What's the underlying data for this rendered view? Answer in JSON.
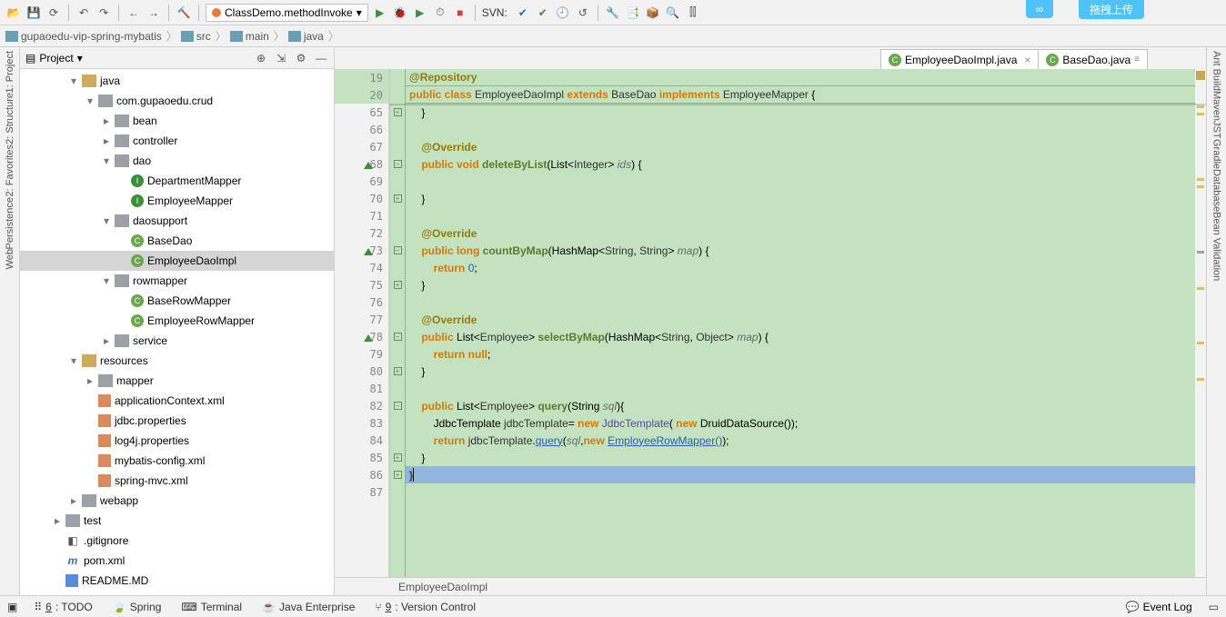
{
  "toolbar": {
    "run_config": "ClassDemo.methodInvoke",
    "svn_label": "SVN:"
  },
  "top_pill_text": "拖拽上传",
  "breadcrumbs": [
    "gupaoedu-vip-spring-mybatis",
    "src",
    "main",
    "java"
  ],
  "project": {
    "title": "Project",
    "tree": [
      {
        "depth": 3,
        "tw": "▾",
        "icon": "dir",
        "label": "java"
      },
      {
        "depth": 4,
        "tw": "▾",
        "icon": "pkg",
        "label": "com.gupaoedu.crud"
      },
      {
        "depth": 5,
        "tw": "▸",
        "icon": "pkg",
        "label": "bean"
      },
      {
        "depth": 5,
        "tw": "▸",
        "icon": "pkg",
        "label": "controller"
      },
      {
        "depth": 5,
        "tw": "▾",
        "icon": "pkg",
        "label": "dao"
      },
      {
        "depth": 6,
        "tw": "",
        "icon": "iface",
        "label": "DepartmentMapper"
      },
      {
        "depth": 6,
        "tw": "",
        "icon": "iface",
        "label": "EmployeeMapper"
      },
      {
        "depth": 5,
        "tw": "▾",
        "icon": "pkg",
        "label": "daosupport"
      },
      {
        "depth": 6,
        "tw": "",
        "icon": "cls",
        "label": "BaseDao"
      },
      {
        "depth": 6,
        "tw": "",
        "icon": "cls",
        "label": "EmployeeDaoImpl",
        "selected": true
      },
      {
        "depth": 5,
        "tw": "▾",
        "icon": "pkg",
        "label": "rowmapper"
      },
      {
        "depth": 6,
        "tw": "",
        "icon": "cls",
        "label": "BaseRowMapper"
      },
      {
        "depth": 6,
        "tw": "",
        "icon": "cls",
        "label": "EmployeeRowMapper"
      },
      {
        "depth": 5,
        "tw": "▸",
        "icon": "pkg",
        "label": "service"
      },
      {
        "depth": 3,
        "tw": "▾",
        "icon": "dir",
        "label": "resources"
      },
      {
        "depth": 4,
        "tw": "▸",
        "icon": "pkg",
        "label": "mapper"
      },
      {
        "depth": 4,
        "tw": "",
        "icon": "xml",
        "label": "applicationContext.xml"
      },
      {
        "depth": 4,
        "tw": "",
        "icon": "prop",
        "label": "jdbc.properties"
      },
      {
        "depth": 4,
        "tw": "",
        "icon": "prop",
        "label": "log4j.properties"
      },
      {
        "depth": 4,
        "tw": "",
        "icon": "xml",
        "label": "mybatis-config.xml"
      },
      {
        "depth": 4,
        "tw": "",
        "icon": "xml",
        "label": "spring-mvc.xml"
      },
      {
        "depth": 3,
        "tw": "▸",
        "icon": "pkg",
        "label": "webapp"
      },
      {
        "depth": 2,
        "tw": "▸",
        "icon": "pkg",
        "label": "test"
      },
      {
        "depth": 2,
        "tw": "",
        "icon": "git",
        "label": ".gitignore"
      },
      {
        "depth": 2,
        "tw": "",
        "icon": "mvn",
        "label": "pom.xml"
      },
      {
        "depth": 2,
        "tw": "",
        "icon": "md",
        "label": "README.MD"
      }
    ]
  },
  "file_tabs": [
    {
      "label": "EmployeeDaoImpl.java",
      "icon": "cls",
      "active": true
    },
    {
      "label": "BaseDao.java",
      "icon": "cls",
      "pinned": true
    }
  ],
  "sticky_lines": [
    {
      "num": "19",
      "tokens": [
        {
          "c": "ann",
          "t": "@Repository"
        }
      ]
    },
    {
      "num": "20",
      "tokens": [
        {
          "c": "kw",
          "t": "public class "
        },
        {
          "c": "type",
          "t": "EmployeeDaoImpl "
        },
        {
          "c": "kw",
          "t": "extends "
        },
        {
          "c": "type",
          "t": "BaseDao "
        },
        {
          "c": "kw",
          "t": "implements "
        },
        {
          "c": "type",
          "t": "EmployeeMapper "
        },
        {
          "c": "",
          "t": "{"
        }
      ]
    }
  ],
  "code_lines": [
    {
      "num": "65",
      "fold": "▸",
      "tokens": [
        {
          "c": "",
          "t": "    }"
        }
      ]
    },
    {
      "num": "66",
      "tokens": []
    },
    {
      "num": "67",
      "tokens": [
        {
          "c": "",
          "t": "    "
        },
        {
          "c": "ann",
          "t": "@Override"
        }
      ]
    },
    {
      "num": "68",
      "mark": "up",
      "fold": "−",
      "tokens": [
        {
          "c": "",
          "t": "    "
        },
        {
          "c": "kw",
          "t": "public void "
        },
        {
          "c": "method",
          "t": "deleteByList"
        },
        {
          "c": "",
          "t": "(List<"
        },
        {
          "c": "type",
          "t": "Integer"
        },
        {
          "c": "",
          "t": "> "
        },
        {
          "c": "param",
          "t": "ids"
        },
        {
          "c": "",
          "t": ") {"
        }
      ]
    },
    {
      "num": "69",
      "tokens": []
    },
    {
      "num": "70",
      "fold": "▸",
      "tokens": [
        {
          "c": "",
          "t": "    }"
        }
      ]
    },
    {
      "num": "71",
      "tokens": []
    },
    {
      "num": "72",
      "tokens": [
        {
          "c": "",
          "t": "    "
        },
        {
          "c": "ann",
          "t": "@Override"
        }
      ]
    },
    {
      "num": "73",
      "mark": "up",
      "fold": "−",
      "tokens": [
        {
          "c": "",
          "t": "    "
        },
        {
          "c": "kw",
          "t": "public long "
        },
        {
          "c": "method",
          "t": "countByMap"
        },
        {
          "c": "",
          "t": "(HashMap<"
        },
        {
          "c": "type",
          "t": "String"
        },
        {
          "c": "",
          "t": ", "
        },
        {
          "c": "type",
          "t": "String"
        },
        {
          "c": "",
          "t": "> "
        },
        {
          "c": "param",
          "t": "map"
        },
        {
          "c": "",
          "t": ") {"
        }
      ]
    },
    {
      "num": "74",
      "tokens": [
        {
          "c": "",
          "t": "        "
        },
        {
          "c": "kw",
          "t": "return "
        },
        {
          "c": "num",
          "t": "0"
        },
        {
          "c": "",
          "t": ";"
        }
      ]
    },
    {
      "num": "75",
      "fold": "▸",
      "tokens": [
        {
          "c": "",
          "t": "    }"
        }
      ]
    },
    {
      "num": "76",
      "tokens": []
    },
    {
      "num": "77",
      "tokens": [
        {
          "c": "",
          "t": "    "
        },
        {
          "c": "ann",
          "t": "@Override"
        }
      ]
    },
    {
      "num": "78",
      "mark": "up",
      "fold": "−",
      "tokens": [
        {
          "c": "",
          "t": "    "
        },
        {
          "c": "kw",
          "t": "public "
        },
        {
          "c": "",
          "t": "List<"
        },
        {
          "c": "type",
          "t": "Employee"
        },
        {
          "c": "",
          "t": "> "
        },
        {
          "c": "method",
          "t": "selectByMap"
        },
        {
          "c": "",
          "t": "(HashMap<"
        },
        {
          "c": "type",
          "t": "String"
        },
        {
          "c": "",
          "t": ", "
        },
        {
          "c": "type",
          "t": "Object"
        },
        {
          "c": "",
          "t": "> "
        },
        {
          "c": "param",
          "t": "map"
        },
        {
          "c": "",
          "t": ") {"
        }
      ]
    },
    {
      "num": "79",
      "tokens": [
        {
          "c": "",
          "t": "        "
        },
        {
          "c": "kw",
          "t": "return null"
        },
        {
          "c": "",
          "t": ";"
        }
      ]
    },
    {
      "num": "80",
      "fold": "▸",
      "tokens": [
        {
          "c": "",
          "t": "    }"
        }
      ]
    },
    {
      "num": "81",
      "tokens": []
    },
    {
      "num": "82",
      "fold": "−",
      "tokens": [
        {
          "c": "",
          "t": "    "
        },
        {
          "c": "kw",
          "t": "public "
        },
        {
          "c": "",
          "t": "List<"
        },
        {
          "c": "type",
          "t": "Employee"
        },
        {
          "c": "",
          "t": "> "
        },
        {
          "c": "method",
          "t": "query"
        },
        {
          "c": "",
          "t": "(String "
        },
        {
          "c": "param",
          "t": "sql"
        },
        {
          "c": "",
          "t": "){"
        }
      ]
    },
    {
      "num": "83",
      "tokens": [
        {
          "c": "",
          "t": "        JdbcTemplate "
        },
        {
          "c": "ident",
          "t": "jdbcTemplate"
        },
        {
          "c": "",
          "t": "= "
        },
        {
          "c": "kw",
          "t": "new "
        },
        {
          "c": "call",
          "t": "JdbcTemplate"
        },
        {
          "c": "",
          "t": "( "
        },
        {
          "c": "kw",
          "t": "new "
        },
        {
          "c": "",
          "t": "DruidDataSource());"
        }
      ]
    },
    {
      "num": "84",
      "tokens": [
        {
          "c": "",
          "t": "        "
        },
        {
          "c": "kw",
          "t": "return "
        },
        {
          "c": "ident",
          "t": "jdbcTemplate"
        },
        {
          "c": "",
          "t": "."
        },
        {
          "c": "link",
          "t": "query"
        },
        {
          "c": "",
          "t": "("
        },
        {
          "c": "param",
          "t": "sql"
        },
        {
          "c": "",
          "t": ","
        },
        {
          "c": "kw",
          "t": "new "
        },
        {
          "c": "link",
          "t": "EmployeeRowMapper()"
        },
        {
          "c": "",
          "t": ");"
        }
      ]
    },
    {
      "num": "85",
      "fold": "▸",
      "tokens": [
        {
          "c": "",
          "t": "    }"
        }
      ]
    },
    {
      "num": "86",
      "hl": true,
      "fold": "▸",
      "tokens": [
        {
          "c": "",
          "t": "}"
        },
        {
          "c": "caret",
          "t": ""
        }
      ]
    },
    {
      "num": "87",
      "tokens": []
    }
  ],
  "editor_breadcrumb": "EmployeeDaoImpl",
  "left_rail": [
    "1: Project",
    "2: Structure",
    "2: Favorites",
    "Persistence",
    "Web"
  ],
  "right_rail": [
    "Ant Build",
    "Maven",
    "JST",
    "Gradle",
    "Database",
    "Bean Validation"
  ],
  "statusbar": {
    "items": [
      {
        "key": "6",
        "label": "TODO"
      },
      {
        "key": "",
        "label": "Spring",
        "icon": "leaf"
      },
      {
        "key": "",
        "label": "Terminal",
        "icon": "term"
      },
      {
        "key": "",
        "label": "Java Enterprise",
        "icon": "cup"
      },
      {
        "key": "9",
        "label": "Version Control",
        "icon": "branch"
      }
    ],
    "event_log": "Event Log"
  }
}
